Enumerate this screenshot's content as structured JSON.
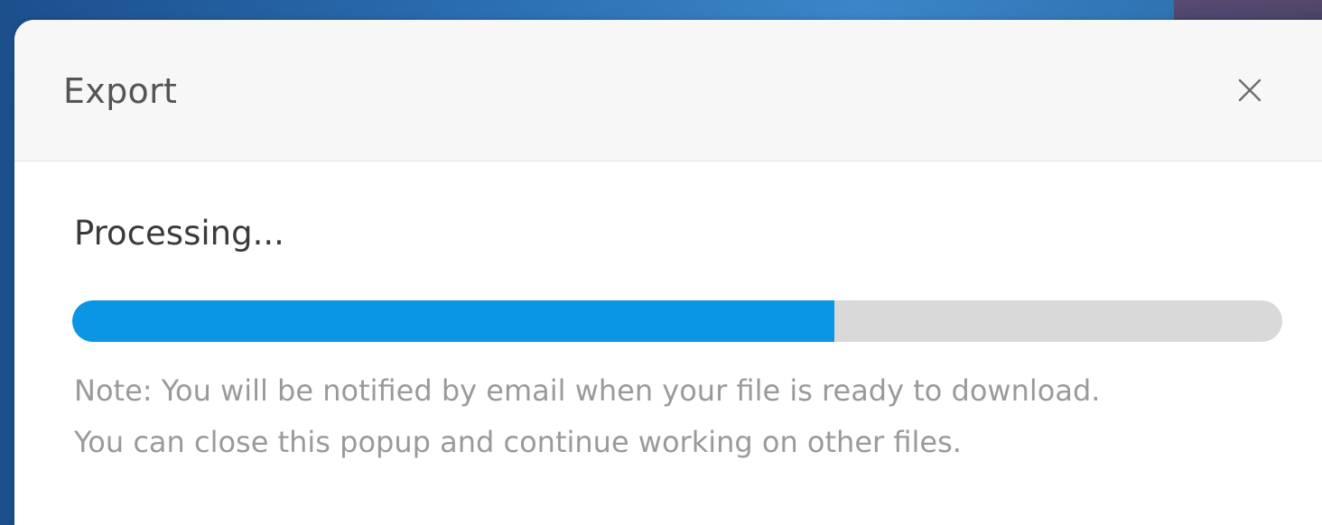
{
  "dialog": {
    "title": "Export",
    "close_icon": "close-icon"
  },
  "status": {
    "text": "Processing...",
    "progress_percent": 63,
    "bar_color": "#0a96e4",
    "track_color": "#d9d9d9"
  },
  "note": {
    "line1": "Note: You will be notified by email when your file is ready to download.",
    "line2": "You can close this popup and continue working on other files."
  }
}
